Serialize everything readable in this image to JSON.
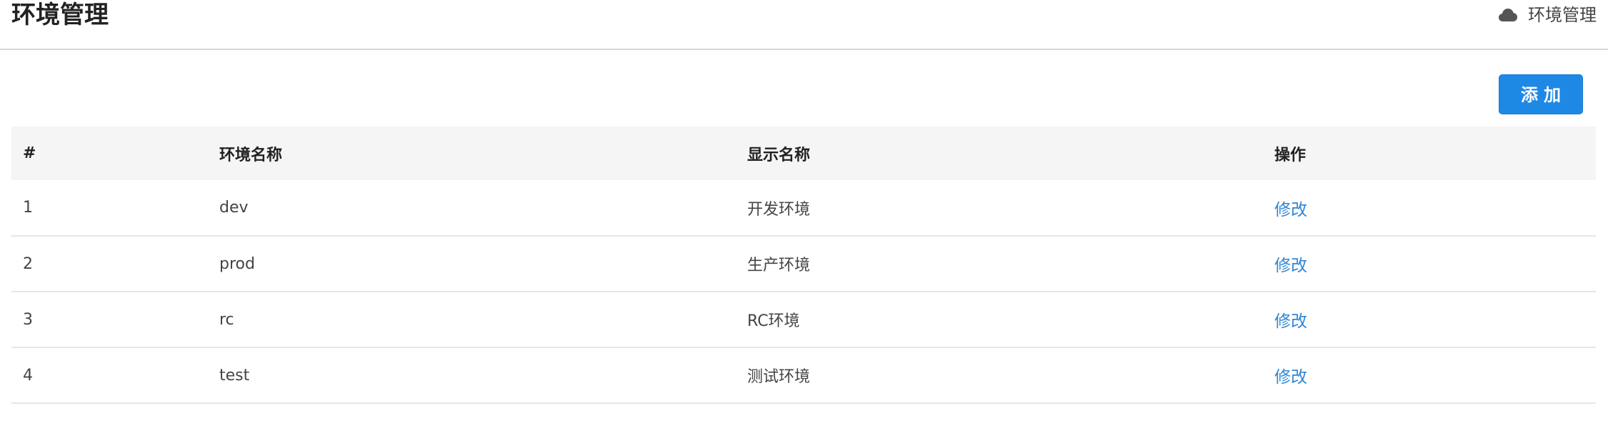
{
  "header": {
    "title": "环境管理",
    "breadcrumb": {
      "icon": "cloud-icon",
      "label": "环境管理"
    }
  },
  "toolbar": {
    "add_label": "添加",
    "accent_color": "#1e88e5"
  },
  "table": {
    "columns": [
      "#",
      "环境名称",
      "显示名称",
      "操作"
    ],
    "rows": [
      {
        "index": "1",
        "name": "dev",
        "display_name": "开发环境",
        "action": "修改"
      },
      {
        "index": "2",
        "name": "prod",
        "display_name": "生产环境",
        "action": "修改"
      },
      {
        "index": "3",
        "name": "rc",
        "display_name": "RC环境",
        "action": "修改"
      },
      {
        "index": "4",
        "name": "test",
        "display_name": "测试环境",
        "action": "修改"
      }
    ],
    "link_color": "#2e86d4"
  }
}
